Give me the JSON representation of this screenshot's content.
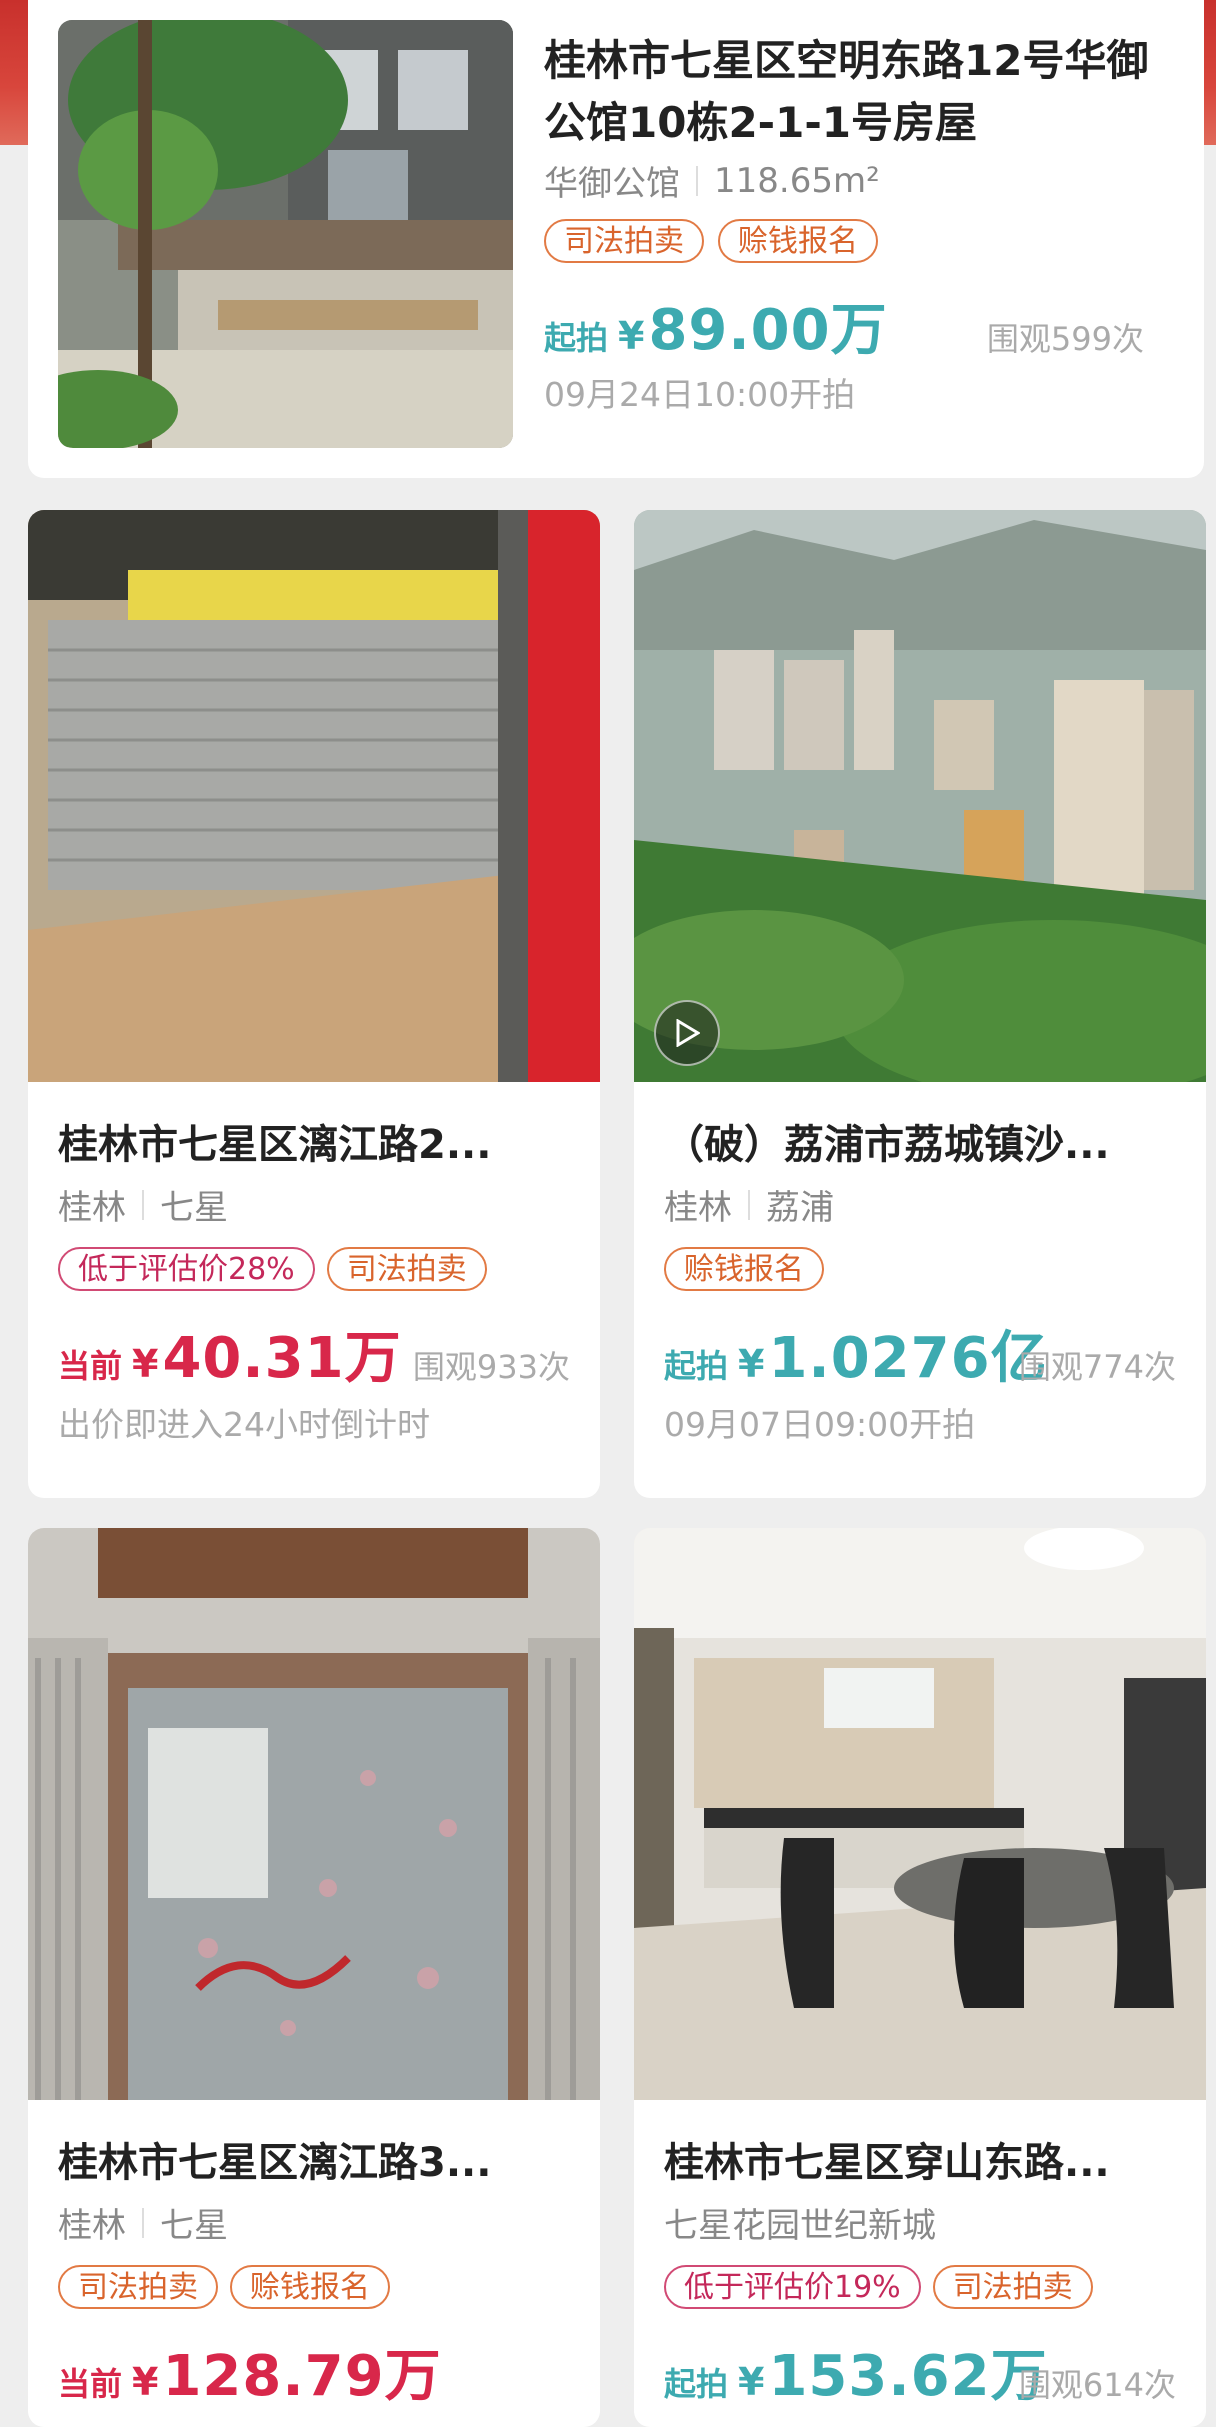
{
  "featured": {
    "title": "桂林市七星区空明东路12号华御公馆10栋2-1-1号房屋",
    "community": "华御公馆",
    "area": "118.65m²",
    "tags": [
      "司法拍卖",
      "赊钱报名"
    ],
    "price_label": "起拍",
    "currency": "¥",
    "price": "89.00万",
    "views": "围观599次",
    "start_time": "09月24日10:00开拍"
  },
  "listings": [
    {
      "title": "桂林市七星区漓江路2...",
      "meta": [
        "桂林",
        "七星"
      ],
      "tags": [
        {
          "text": "低于评估价28%",
          "style": "pink"
        },
        {
          "text": "司法拍卖",
          "style": "orange"
        }
      ],
      "price_label": "当前",
      "currency": "¥",
      "price": "40.31万",
      "views": "围观933次",
      "note": "出价即进入24小时倒计时",
      "price_color": "#d8274a"
    },
    {
      "title": "（破）荔浦市荔城镇沙...",
      "meta": [
        "桂林",
        "荔浦"
      ],
      "tags": [
        {
          "text": "赊钱报名",
          "style": "orange"
        }
      ],
      "price_label": "起拍",
      "currency": "¥",
      "price": "1.0276亿",
      "views": "围观774次",
      "note": "09月07日09:00开拍",
      "price_color": "#3daab0"
    },
    {
      "title": "桂林市七星区漓江路3...",
      "meta": [
        "桂林",
        "七星"
      ],
      "tags": [
        {
          "text": "司法拍卖",
          "style": "orange"
        },
        {
          "text": "赊钱报名",
          "style": "orange"
        }
      ],
      "price_label": "当前",
      "currency": "¥",
      "price": "128.79万",
      "views": "",
      "note": "",
      "price_color": "#d8274a"
    },
    {
      "title": "桂林市七星区穿山东路...",
      "meta": [
        "七星花园世纪新城"
      ],
      "tags": [
        {
          "text": "低于评估价19%",
          "style": "pink"
        },
        {
          "text": "司法拍卖",
          "style": "orange"
        }
      ],
      "price_label": "起拍",
      "currency": "¥",
      "price": "153.62万",
      "views": "围观614次",
      "note": "",
      "price_color": "#3daab0"
    }
  ],
  "icons": {
    "play": "play-icon"
  }
}
